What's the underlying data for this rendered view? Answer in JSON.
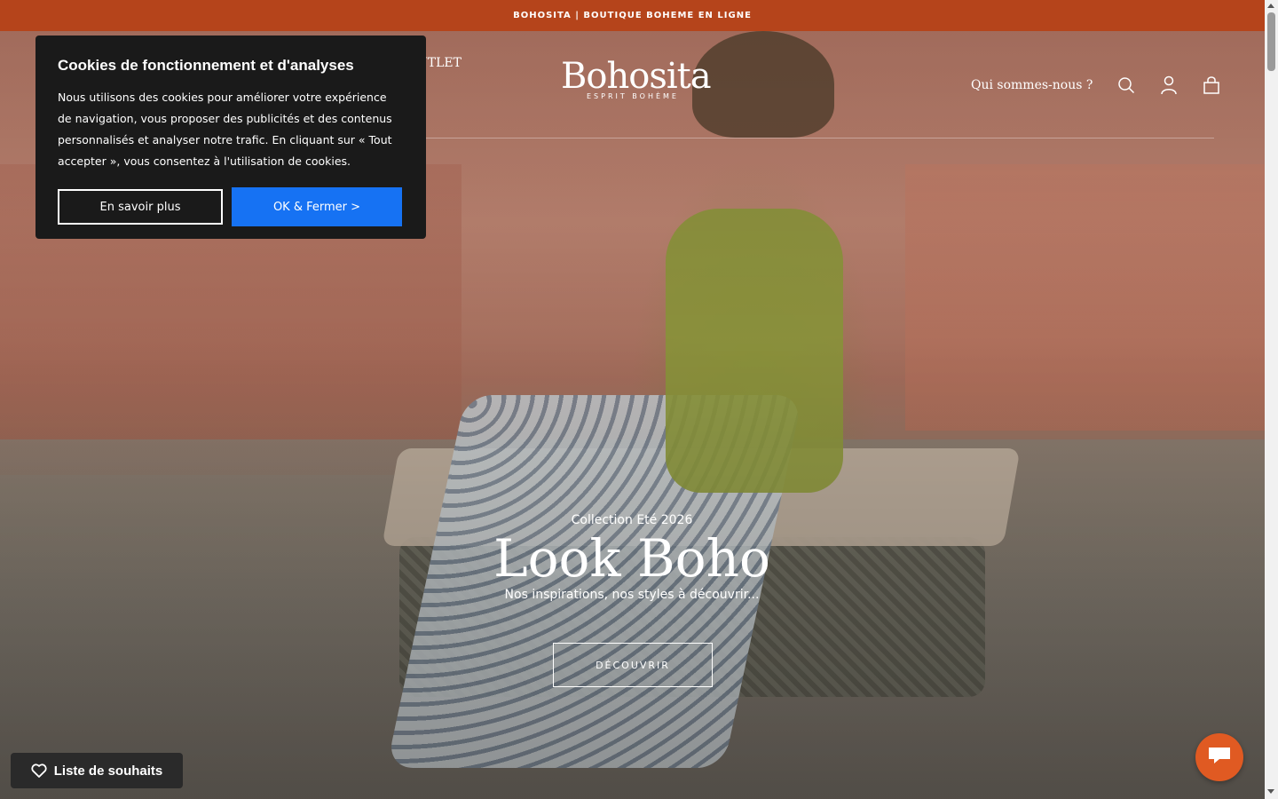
{
  "announcement": {
    "text": "BOHOSITA | BOUTIQUE BOHEME EN LIGNE"
  },
  "header": {
    "nav_partial": "UTLET",
    "logo_name": "Bohosita",
    "logo_tagline": "ESPRIT BOHÈME",
    "about_link": "Qui sommes-nous ?",
    "icons": [
      "search-icon",
      "account-icon",
      "cart-icon"
    ]
  },
  "hero": {
    "eyebrow": "Collection Eté 2026",
    "title": "Look Boho",
    "subtitle": "Nos inspirations, nos styles à découvrir...",
    "cta_label": "DÉCOUVRIR"
  },
  "cookie_banner": {
    "title": "Cookies de fonctionnement et d'analyses",
    "body": "Nous utilisons des cookies pour améliorer votre expérience de navigation, vous proposer des publicités et des contenus personnalisés et analyser notre trafic. En cliquant sur « Tout accepter », vous consentez à l'utilisation de cookies.",
    "learn_more_label": "En savoir plus",
    "accept_label": "OK & Fermer >"
  },
  "wishlist": {
    "label": "Liste de souhaits"
  },
  "colors": {
    "announcement_bg": "#b5441b",
    "accept_button": "#1672f3",
    "chat_button": "#e05a22",
    "cookie_bg": "#1a1a1a"
  }
}
